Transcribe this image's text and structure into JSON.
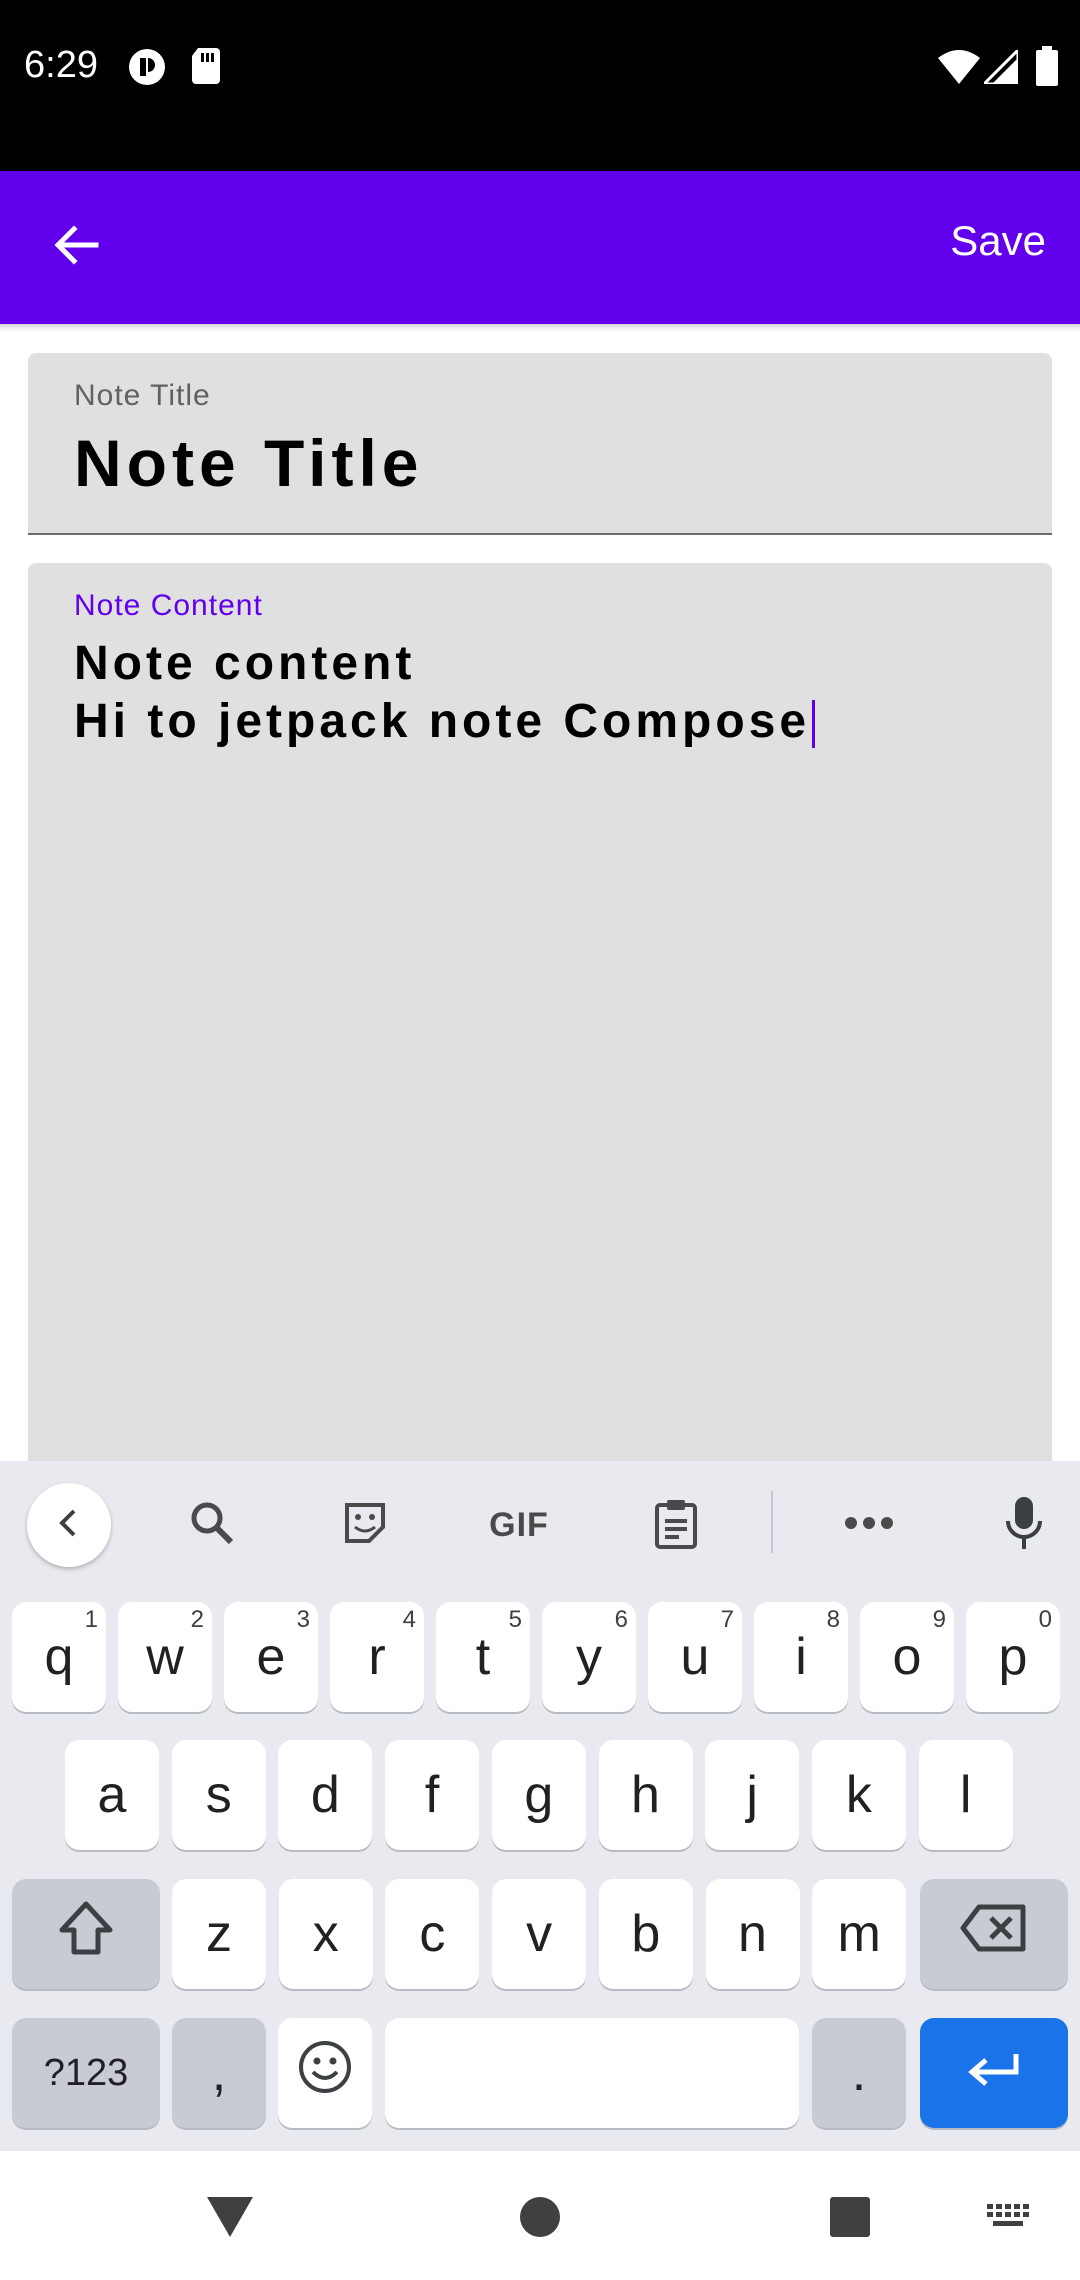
{
  "status_bar": {
    "time": "6:29",
    "icons": [
      "notification-app-icon",
      "sim-card-icon",
      "wifi-icon",
      "cell-signal-icon",
      "battery-icon"
    ]
  },
  "app_bar": {
    "back_icon": "arrow-back-icon",
    "save_label": "Save",
    "color": "#6200ee"
  },
  "note": {
    "title_label": "Note Title",
    "title_value": "Note Title",
    "content_label": "Note Content",
    "content_line1": "Note content",
    "content_line2": "Hi to jetpack note Compose"
  },
  "keyboard": {
    "toolbar": [
      "chevron-left-icon",
      "search-icon",
      "sticker-icon",
      "GIF",
      "clipboard-icon",
      "more-icon",
      "mic-icon"
    ],
    "row1": [
      {
        "k": "q",
        "n": "1"
      },
      {
        "k": "w",
        "n": "2"
      },
      {
        "k": "e",
        "n": "3"
      },
      {
        "k": "r",
        "n": "4"
      },
      {
        "k": "t",
        "n": "5"
      },
      {
        "k": "y",
        "n": "6"
      },
      {
        "k": "u",
        "n": "7"
      },
      {
        "k": "i",
        "n": "8"
      },
      {
        "k": "o",
        "n": "9"
      },
      {
        "k": "p",
        "n": "0"
      }
    ],
    "row2": [
      "a",
      "s",
      "d",
      "f",
      "g",
      "h",
      "j",
      "k",
      "l"
    ],
    "row3": [
      "z",
      "x",
      "c",
      "v",
      "b",
      "n",
      "m"
    ],
    "symbols_label": "?123",
    "comma": ",",
    "period": ".",
    "enter_color": "#1a73e8"
  },
  "nav_bar": {
    "icons": [
      "back-triangle-icon",
      "home-circle-icon",
      "recents-square-icon",
      "keyboard-switch-icon"
    ]
  }
}
